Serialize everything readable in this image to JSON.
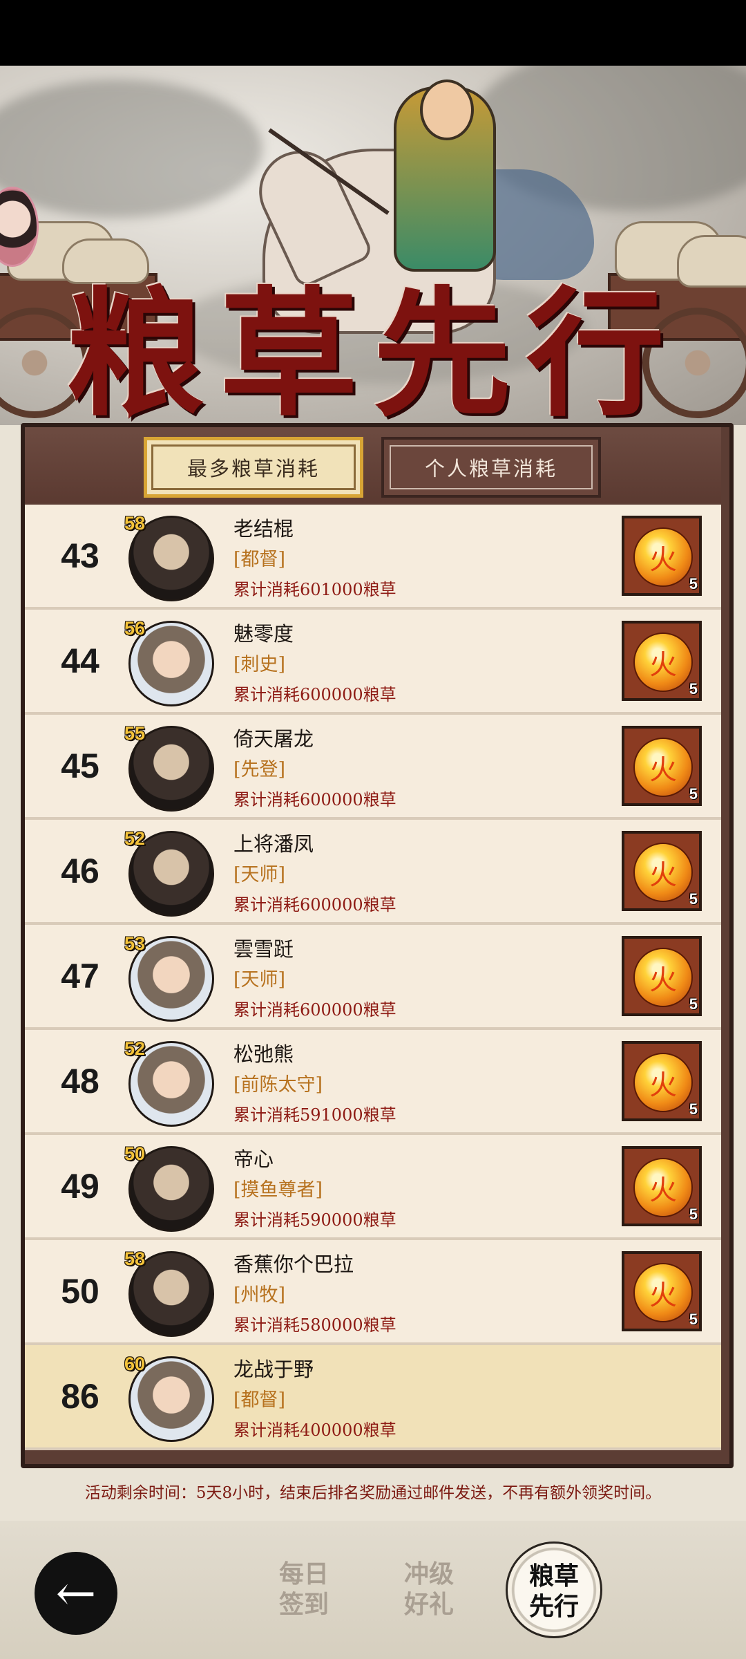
{
  "banner": {
    "title": "粮草先行"
  },
  "tabs": {
    "most_consume": "最多粮草消耗",
    "personal_consume": "个人粮草消耗"
  },
  "rows": [
    {
      "rank": "43",
      "level": "58",
      "name": "老结棍",
      "title": "[都督]",
      "consume": "累计消耗601000粮草",
      "reward_count": "5",
      "avatar": "dark"
    },
    {
      "rank": "44",
      "level": "56",
      "name": "魅零度",
      "title": "[刺史]",
      "consume": "累计消耗600000粮草",
      "reward_count": "5",
      "avatar": "light"
    },
    {
      "rank": "45",
      "level": "55",
      "name": "倚天屠龙",
      "title": "[先登]",
      "consume": "累计消耗600000粮草",
      "reward_count": "5",
      "avatar": "dark"
    },
    {
      "rank": "46",
      "level": "52",
      "name": "上将潘凤",
      "title": "[天师]",
      "consume": "累计消耗600000粮草",
      "reward_count": "5",
      "avatar": "dark"
    },
    {
      "rank": "47",
      "level": "53",
      "name": "雲雪跹",
      "title": "[天师]",
      "consume": "累计消耗600000粮草",
      "reward_count": "5",
      "avatar": "light"
    },
    {
      "rank": "48",
      "level": "52",
      "name": "松弛熊",
      "title": "[前陈太守]",
      "consume": "累计消耗591000粮草",
      "reward_count": "5",
      "avatar": "light"
    },
    {
      "rank": "49",
      "level": "50",
      "name": "帝心",
      "title": "[摸鱼尊者]",
      "consume": "累计消耗590000粮草",
      "reward_count": "5",
      "avatar": "dark"
    },
    {
      "rank": "50",
      "level": "58",
      "name": "香蕉你个巴拉",
      "title": "[州牧]",
      "consume": "累计消耗580000粮草",
      "reward_count": "5",
      "avatar": "dark"
    }
  ],
  "self_row": {
    "rank": "86",
    "level": "60",
    "name": "龙战于野",
    "title": "[都督]",
    "consume": "累计消耗400000粮草"
  },
  "notice": "活动剩余时间：5天8小时，结束后排名奖励通过邮件发送，不再有额外领奖时间。",
  "nav": {
    "back_icon": "left-arrow-icon",
    "daily_signin": [
      "每日",
      "签到"
    ],
    "level_gift": [
      "冲级",
      "好礼"
    ],
    "grain_first": [
      "粮草",
      "先行"
    ]
  }
}
